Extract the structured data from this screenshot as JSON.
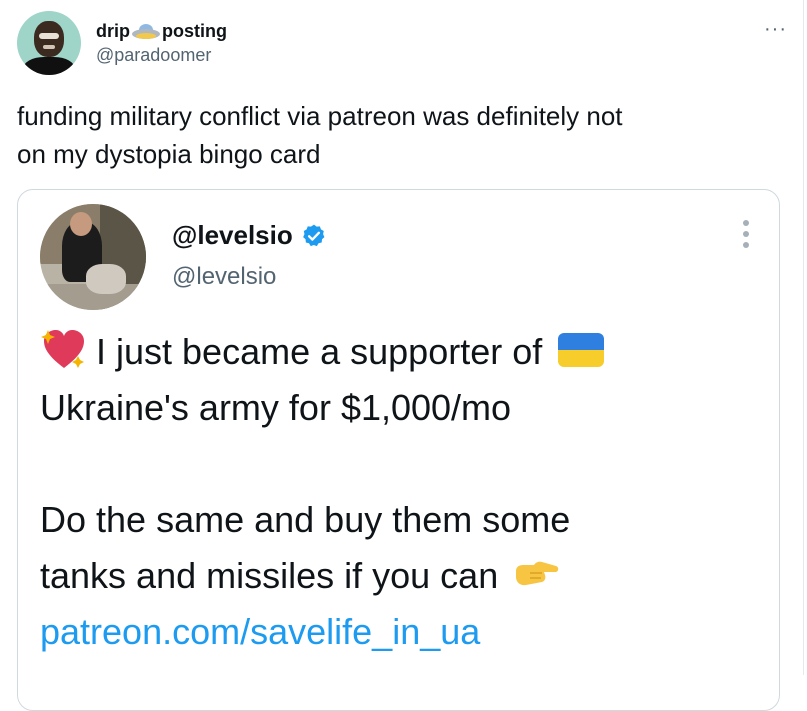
{
  "tweet": {
    "author": {
      "name_part1": "drip",
      "name_emoji": "flying-saucer",
      "name_part2": "posting",
      "handle": "@paradoomer"
    },
    "more_label": "···",
    "text_line1": "funding military conflict via patreon was definitely not",
    "text_line2": "on my dystopia bingo card"
  },
  "quoted": {
    "name": "@levelsio",
    "verified": true,
    "handle": "@levelsio",
    "line1": "I just became a supporter of",
    "line2": "Ukraine's army for $1,000/mo",
    "line3": "Do the same and buy them some",
    "line4": "tanks and missiles if you can",
    "link": "patreon.com/savelife_in_ua",
    "icons": [
      "sparkling-heart",
      "ukraine-flag",
      "pointing-right-hand"
    ]
  },
  "colors": {
    "text": "#0f1419",
    "secondary": "#536471",
    "link": "#1d9bf0",
    "verified": "#1d9bf0",
    "border": "#cfd9de"
  }
}
